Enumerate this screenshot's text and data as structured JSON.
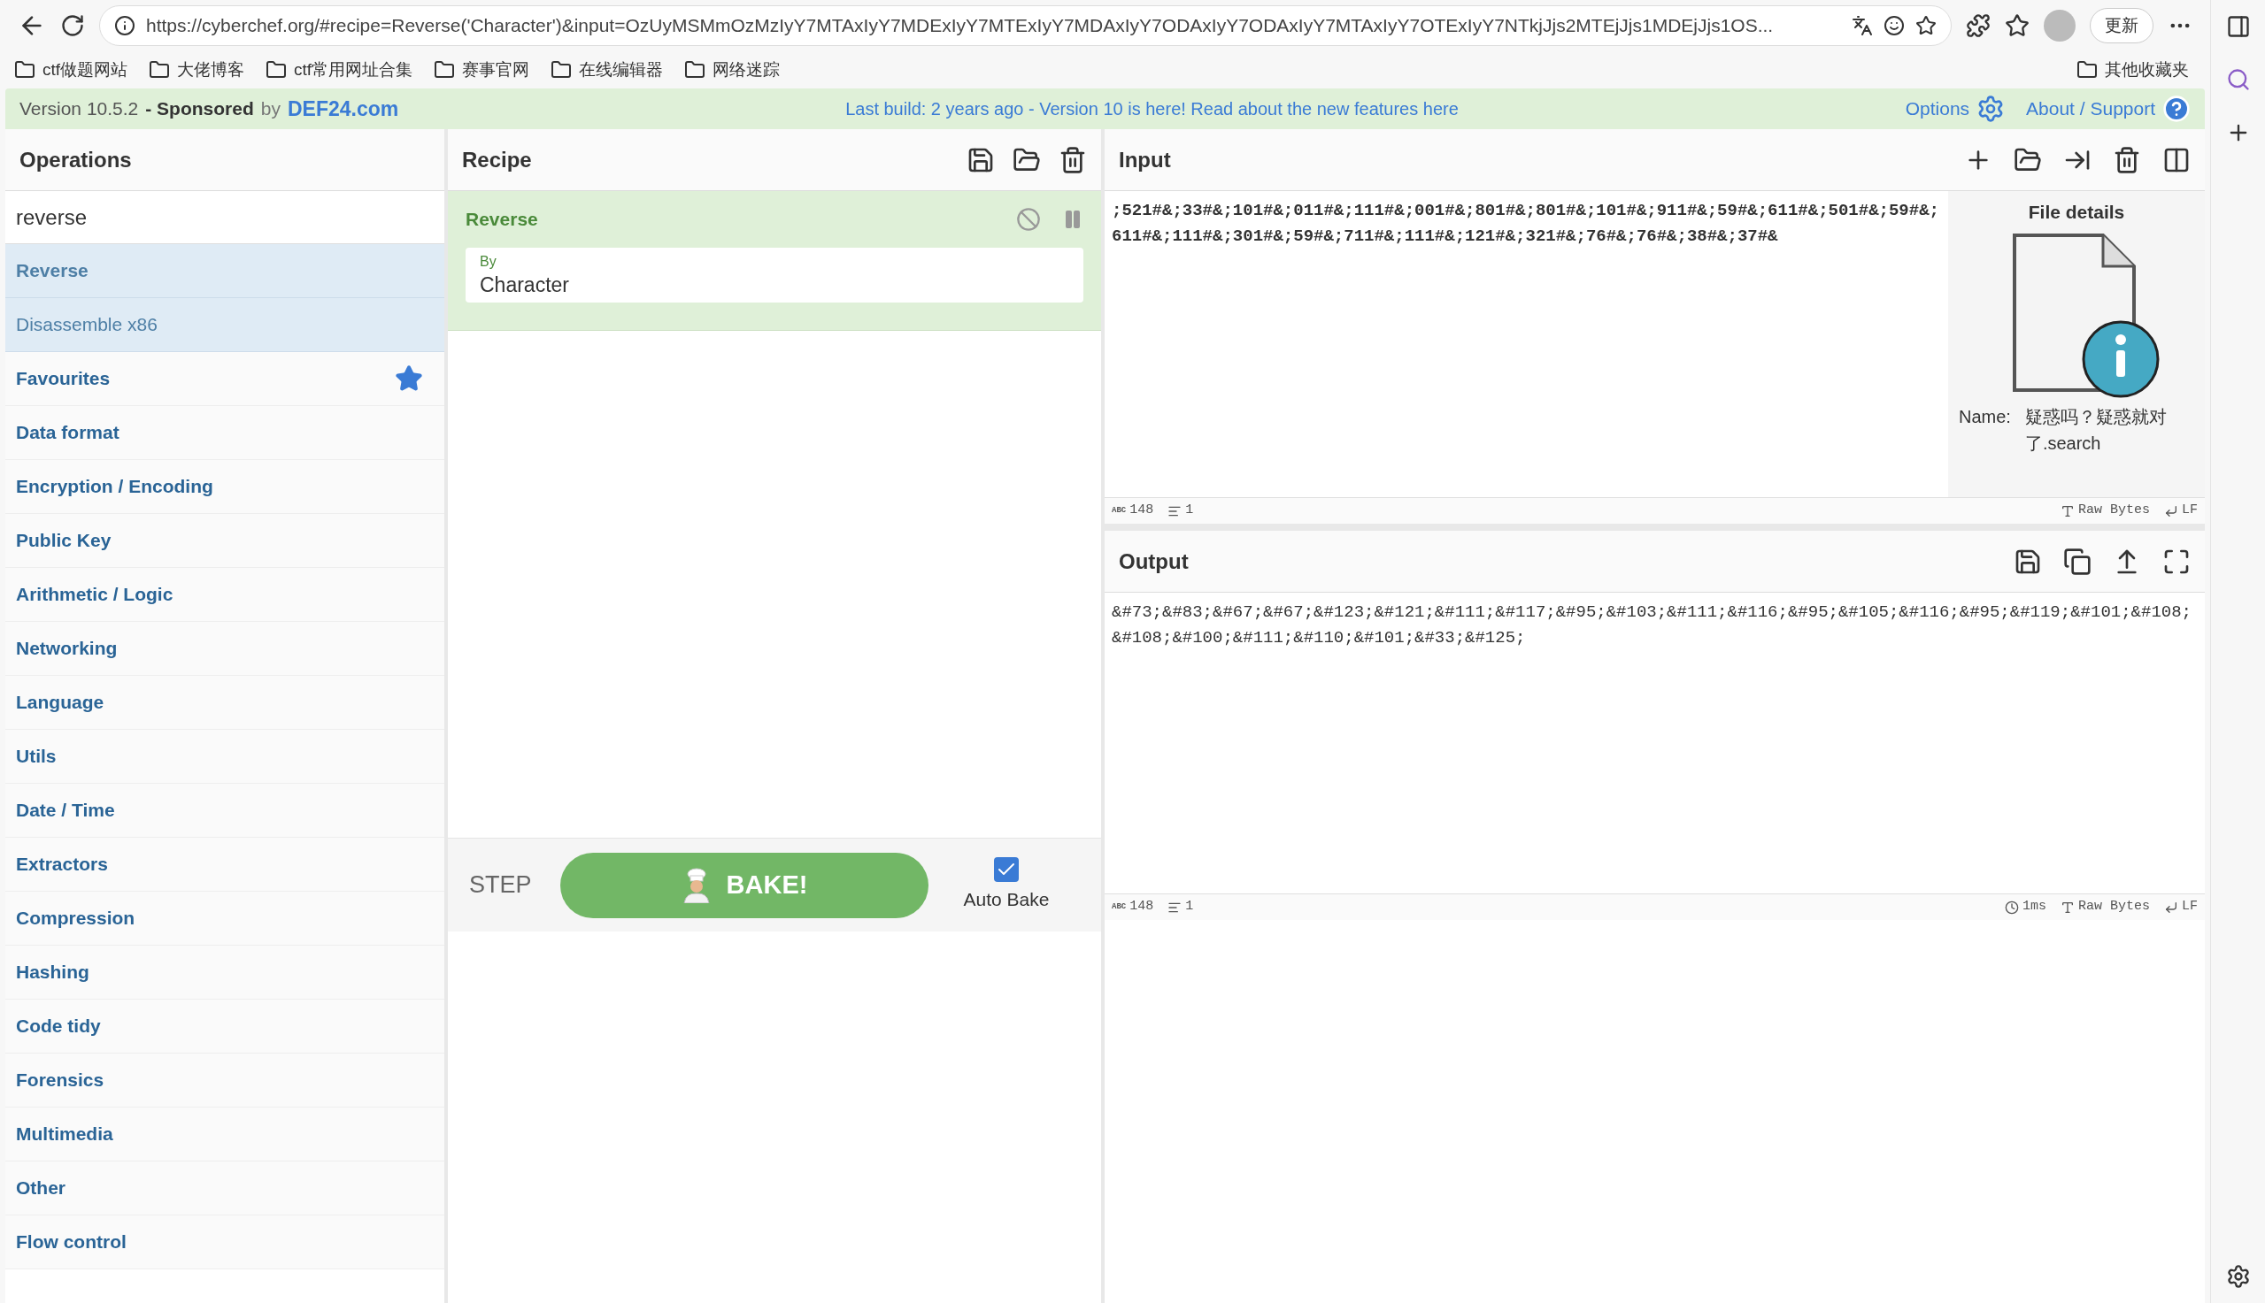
{
  "browser": {
    "url": "https://cyberchef.org/#recipe=Reverse('Character')&input=OzUyMSMmOzMzIyY7MTAxIyY7MDExIyY7MTExIyY7MDAxIyY7ODAxIyY7ODAxIyY7MTAxIyY7OTExIyY7NTkjJjs2MTEjJjs1MDEjJjs1OS...",
    "update_button": "更新",
    "bookmarks": [
      {
        "label": "ctf做题网站"
      },
      {
        "label": "大佬博客"
      },
      {
        "label": "ctf常用网址合集"
      },
      {
        "label": "赛事官网"
      },
      {
        "label": "在线编辑器"
      },
      {
        "label": "网络迷踪"
      }
    ],
    "other_bookmarks": "其他收藏夹"
  },
  "banner": {
    "version": "Version 10.5.2",
    "sponsored": "- Sponsored",
    "by": "by",
    "sponsor": "DEF24.com",
    "news": "Last build: 2 years ago - Version 10 is here! Read about the new features here",
    "options": "Options",
    "about": "About / Support"
  },
  "operations": {
    "title": "Operations",
    "search_value": "reverse",
    "results": [
      {
        "label": "Reverse",
        "selected": true
      },
      {
        "label": "Disassemble x86",
        "selected": false
      }
    ],
    "categories": [
      {
        "label": "Favourites",
        "kind": "favourites"
      },
      {
        "label": "Data format",
        "kind": "plain"
      },
      {
        "label": "Encryption / Encoding",
        "kind": "plain"
      },
      {
        "label": "Public Key",
        "kind": "plain"
      },
      {
        "label": "Arithmetic / Logic",
        "kind": "plain"
      },
      {
        "label": "Networking",
        "kind": "plain"
      },
      {
        "label": "Language",
        "kind": "plain"
      },
      {
        "label": "Utils",
        "kind": "plain"
      },
      {
        "label": "Date / Time",
        "kind": "plain"
      },
      {
        "label": "Extractors",
        "kind": "plain"
      },
      {
        "label": "Compression",
        "kind": "plain"
      },
      {
        "label": "Hashing",
        "kind": "plain"
      },
      {
        "label": "Code tidy",
        "kind": "plain"
      },
      {
        "label": "Forensics",
        "kind": "plain"
      },
      {
        "label": "Multimedia",
        "kind": "plain"
      },
      {
        "label": "Other",
        "kind": "plain"
      },
      {
        "label": "Flow control",
        "kind": "plain"
      }
    ]
  },
  "recipe": {
    "title": "Recipe",
    "ops": [
      {
        "name": "Reverse",
        "arg_label": "By",
        "arg_value": "Character",
        "disabled": false
      }
    ],
    "step": "STEP",
    "bake": "BAKE!",
    "auto_bake": {
      "label": "Auto Bake",
      "checked": true
    }
  },
  "input": {
    "title": "Input",
    "text": ";521#&;33#&;101#&;011#&;111#&;001#&;801#&;801#&;101#&;911#&;59#&;611#&;501#&;59#&;611#&;111#&;301#&;59#&;711#&;111#&;121#&;321#&;76#&;76#&;38#&;37#&",
    "file_details": {
      "title": "File details",
      "name_label": "Name:",
      "name_value": "疑惑吗？疑惑就对了.search"
    },
    "status": {
      "length_label": "ABC",
      "length": "148",
      "lines": "1",
      "charset": "Raw Bytes",
      "eol": "LF"
    }
  },
  "output": {
    "title": "Output",
    "text": "&#73;&#83;&#67;&#67;&#123;&#121;&#111;&#117;&#95;&#103;&#111;&#116;&#95;&#105;&#116;&#95;&#119;&#101;&#108;&#108;&#100;&#111;&#110;&#101;&#33;&#125;",
    "status": {
      "length_label": "ABC",
      "length": "148",
      "lines": "1",
      "time": "1ms",
      "charset": "Raw Bytes",
      "eol": "LF"
    }
  }
}
